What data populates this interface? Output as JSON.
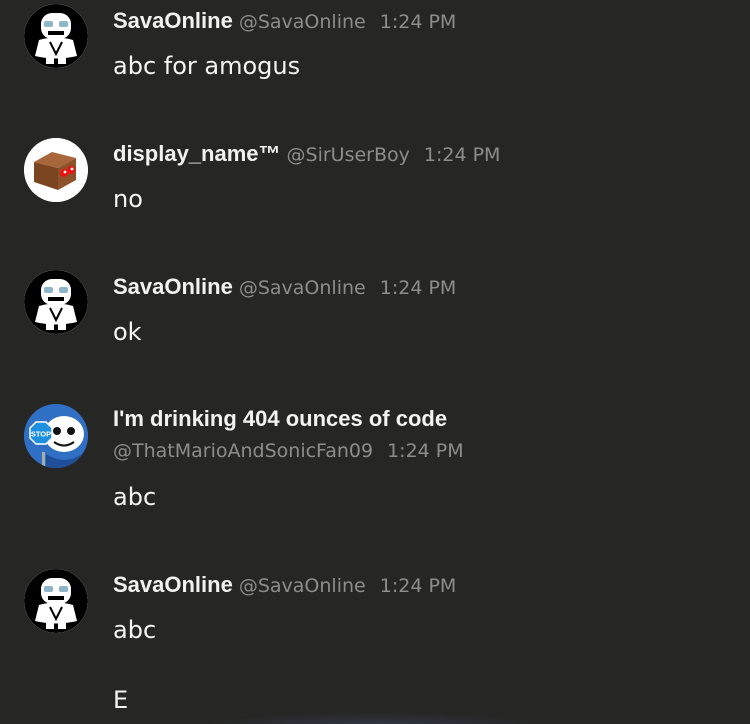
{
  "messages": [
    {
      "avatar": "sans-skeleton-avatar",
      "name": "SavaOnline",
      "handle": "@SavaOnline",
      "time": "1:24 PM",
      "text": "abc for amogus"
    },
    {
      "avatar": "brown-box-avatar",
      "name": "display_name™",
      "handle": "@SirUserBoy",
      "time": "1:24 PM",
      "text": "no"
    },
    {
      "avatar": "sans-skeleton-avatar",
      "name": "SavaOnline",
      "handle": "@SavaOnline",
      "time": "1:24 PM",
      "text": "ok"
    },
    {
      "avatar": "sans-stop-sign-avatar",
      "name": "I'm drinking 404 ounces of code",
      "handle": "@ThatMarioAndSonicFan09",
      "time": "1:24 PM",
      "text": "abc"
    },
    {
      "avatar": "sans-skeleton-avatar",
      "name": "SavaOnline",
      "handle": "@SavaOnline",
      "time": "1:24 PM",
      "text": "abc",
      "text2": "E"
    }
  ],
  "colors": {
    "background": "#262624",
    "name": "#f2f2f2",
    "meta": "#8d8d8d",
    "text": "#f4f4f4"
  }
}
